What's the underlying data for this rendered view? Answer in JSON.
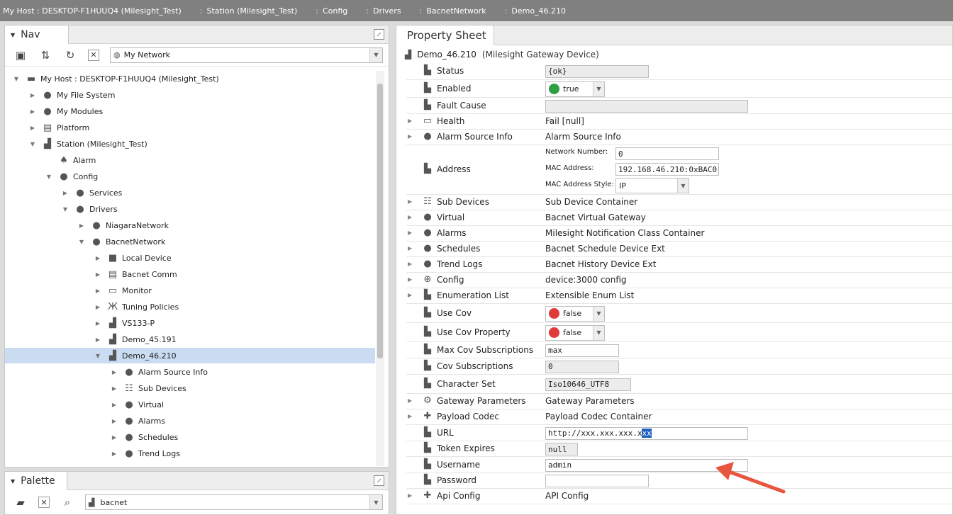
{
  "breadcrumb": [
    {
      "label": "My Host : DESKTOP-F1HUUQ4 (Milesight_Test)"
    },
    {
      "label": "Station (Milesight_Test)"
    },
    {
      "label": "Config"
    },
    {
      "label": "Drivers"
    },
    {
      "label": "BacnetNetwork"
    },
    {
      "label": "Demo_46.210"
    }
  ],
  "nav": {
    "title": "Nav",
    "network_select": "My Network",
    "tree": [
      {
        "label": "My Host : DESKTOP-F1HUUQ4 (Milesight_Test)",
        "icon": "host-icon",
        "depth": 0,
        "toggle": "▼",
        "glyph": "▬"
      },
      {
        "label": "My File System",
        "icon": "file-system-icon",
        "depth": 1,
        "toggle": "▶",
        "glyph": "●"
      },
      {
        "label": "My Modules",
        "icon": "modules-icon",
        "depth": 1,
        "toggle": "▶",
        "glyph": "●"
      },
      {
        "label": "Platform",
        "icon": "platform-icon",
        "depth": 1,
        "toggle": "▶",
        "glyph": "▤"
      },
      {
        "label": "Station (Milesight_Test)",
        "icon": "station-icon",
        "depth": 1,
        "toggle": "▼",
        "glyph": "▟"
      },
      {
        "label": "Alarm",
        "icon": "bell-icon",
        "depth": 2,
        "toggle": "",
        "glyph": "♠"
      },
      {
        "label": "Config",
        "icon": "config-icon",
        "depth": 2,
        "toggle": "▼",
        "glyph": "●"
      },
      {
        "label": "Services",
        "icon": "services-icon",
        "depth": 3,
        "toggle": "▶",
        "glyph": "●"
      },
      {
        "label": "Drivers",
        "icon": "drivers-icon",
        "depth": 3,
        "toggle": "▼",
        "glyph": "●"
      },
      {
        "label": "NiagaraNetwork",
        "icon": "network-icon",
        "depth": 4,
        "toggle": "▶",
        "glyph": "●"
      },
      {
        "label": "BacnetNetwork",
        "icon": "network-icon",
        "depth": 4,
        "toggle": "▼",
        "glyph": "●"
      },
      {
        "label": "Local Device",
        "icon": "local-device-icon",
        "depth": 5,
        "toggle": "▶",
        "glyph": "■"
      },
      {
        "label": "Bacnet Comm",
        "icon": "bacnet-comm-icon",
        "depth": 5,
        "toggle": "▶",
        "glyph": "▤"
      },
      {
        "label": "Monitor",
        "icon": "monitor-icon",
        "depth": 5,
        "toggle": "▶",
        "glyph": "▭"
      },
      {
        "label": "Tuning Policies",
        "icon": "tuning-icon",
        "depth": 5,
        "toggle": "▶",
        "glyph": "Ж"
      },
      {
        "label": "VS133-P",
        "icon": "device-icon",
        "depth": 5,
        "toggle": "▶",
        "glyph": "▟"
      },
      {
        "label": "Demo_45.191",
        "icon": "device-icon",
        "depth": 5,
        "toggle": "▶",
        "glyph": "▟"
      },
      {
        "label": "Demo_46.210",
        "icon": "device-icon",
        "depth": 5,
        "toggle": "▼",
        "glyph": "▟",
        "selected": true
      },
      {
        "label": "Alarm Source Info",
        "icon": "alarm-source-icon",
        "depth": 6,
        "toggle": "▶",
        "glyph": "●"
      },
      {
        "label": "Sub Devices",
        "icon": "sub-devices-icon",
        "depth": 6,
        "toggle": "▶",
        "glyph": "☷"
      },
      {
        "label": "Virtual",
        "icon": "virtual-icon",
        "depth": 6,
        "toggle": "▶",
        "glyph": "●"
      },
      {
        "label": "Alarms",
        "icon": "alarms-icon",
        "depth": 6,
        "toggle": "▶",
        "glyph": "●"
      },
      {
        "label": "Schedules",
        "icon": "schedules-icon",
        "depth": 6,
        "toggle": "▶",
        "glyph": "●"
      },
      {
        "label": "Trend Logs",
        "icon": "trend-logs-icon",
        "depth": 6,
        "toggle": "▶",
        "glyph": "●"
      }
    ]
  },
  "palette": {
    "title": "Palette",
    "select": "bacnet"
  },
  "property_sheet": {
    "tab": "Property Sheet",
    "device_name": "Demo_46.210",
    "device_type": "(Milesight Gateway Device)",
    "rows": [
      {
        "name": "Status",
        "icon": "slot-icon",
        "glyph": "▙",
        "exp": "",
        "kind": "field",
        "value": "{ok}",
        "ro": true,
        "fw": 146,
        "h": 25
      },
      {
        "name": "Enabled",
        "icon": "slot-icon",
        "glyph": "▙",
        "exp": "",
        "kind": "bool",
        "value": "true",
        "dot": "#2ea043",
        "h": 25
      },
      {
        "name": "Fault Cause",
        "icon": "slot-icon",
        "glyph": "▙",
        "exp": "",
        "kind": "field",
        "value": "",
        "ro": true,
        "fw": 286,
        "h": 23
      },
      {
        "name": "Health",
        "icon": "health-icon",
        "glyph": "▭",
        "exp": "▶",
        "kind": "text",
        "value": "Fail [null]",
        "h": 22
      },
      {
        "name": "Alarm Source Info",
        "icon": "alarm-source-icon",
        "glyph": "●",
        "exp": "▶",
        "kind": "text",
        "value": "Alarm Source Info",
        "h": 22
      },
      {
        "name": "Address",
        "icon": "slot-icon",
        "glyph": "▙",
        "exp": "",
        "kind": "address",
        "h": 70
      },
      {
        "name": "Sub Devices",
        "icon": "sub-devices-icon",
        "glyph": "☷",
        "exp": "▶",
        "kind": "text",
        "value": "Sub Device Container",
        "h": 22
      },
      {
        "name": "Virtual",
        "icon": "virtual-icon",
        "glyph": "●",
        "exp": "▶",
        "kind": "text",
        "value": "Bacnet Virtual Gateway",
        "h": 22
      },
      {
        "name": "Alarms",
        "icon": "alarms-icon",
        "glyph": "●",
        "exp": "▶",
        "kind": "text",
        "value": "Milesight Notification Class Container",
        "h": 22
      },
      {
        "name": "Schedules",
        "icon": "schedules-icon",
        "glyph": "●",
        "exp": "▶",
        "kind": "text",
        "value": "Bacnet Schedule Device Ext",
        "h": 22
      },
      {
        "name": "Trend Logs",
        "icon": "trend-logs-icon",
        "glyph": "●",
        "exp": "▶",
        "kind": "text",
        "value": "Bacnet History Device Ext",
        "h": 22
      },
      {
        "name": "Config",
        "icon": "config-icon",
        "glyph": "⊕",
        "exp": "▶",
        "kind": "text",
        "value": "device:3000 config",
        "h": 22
      },
      {
        "name": "Enumeration List",
        "icon": "slot-icon",
        "glyph": "▙",
        "exp": "▶",
        "kind": "text",
        "value": "Extensible Enum List",
        "h": 22
      },
      {
        "name": "Use Cov",
        "icon": "slot-icon",
        "glyph": "▙",
        "exp": "",
        "kind": "bool",
        "value": "false",
        "dot": "#e03a3a",
        "h": 27
      },
      {
        "name": "Use Cov Property",
        "icon": "slot-icon",
        "glyph": "▙",
        "exp": "",
        "kind": "bool",
        "value": "false",
        "dot": "#e03a3a",
        "h": 27
      },
      {
        "name": "Max Cov Subscriptions",
        "icon": "slot-icon",
        "glyph": "▙",
        "exp": "",
        "kind": "field",
        "value": "max",
        "ro": false,
        "fw": 104,
        "h": 23
      },
      {
        "name": "Cov Subscriptions",
        "icon": "slot-icon",
        "glyph": "▙",
        "exp": "",
        "kind": "field",
        "value": "0",
        "ro": true,
        "fw": 104,
        "h": 23
      },
      {
        "name": "Character Set",
        "icon": "slot-icon",
        "glyph": "▙",
        "exp": "",
        "kind": "field",
        "value": "Iso10646_UTF8",
        "ro": true,
        "fw": 121,
        "h": 27
      },
      {
        "name": "Gateway Parameters",
        "icon": "gear-icon",
        "glyph": "⚙",
        "exp": "▶",
        "kind": "text",
        "value": "Gateway Parameters",
        "h": 22
      },
      {
        "name": "Payload Codec",
        "icon": "puzzle-icon",
        "glyph": "✚",
        "exp": "▶",
        "kind": "text",
        "value": "Payload Codec Container",
        "h": 22
      },
      {
        "name": "URL",
        "icon": "slot-icon",
        "glyph": "▙",
        "exp": "",
        "kind": "url",
        "value": "http://xxx.xxx.xxx.x",
        "sel": "xx",
        "fw": 286,
        "h": 23
      },
      {
        "name": "Token Expires",
        "icon": "slot-icon",
        "glyph": "▙",
        "exp": "",
        "kind": "field",
        "value": "null",
        "ro": true,
        "fw": 46,
        "h": 22
      },
      {
        "name": "Username",
        "icon": "slot-icon",
        "glyph": "▙",
        "exp": "",
        "kind": "field",
        "value": "admin",
        "ro": false,
        "fw": 286,
        "h": 23
      },
      {
        "name": "Password",
        "icon": "slot-icon",
        "glyph": "▙",
        "exp": "",
        "kind": "field",
        "value": "",
        "ro": false,
        "fw": 146,
        "h": 22
      },
      {
        "name": "Api Config",
        "icon": "puzzle-icon",
        "glyph": "✚",
        "exp": "▶",
        "kind": "text",
        "value": "API Config",
        "h": 22
      }
    ],
    "address": {
      "network_number_label": "Network Number:",
      "network_number": "0",
      "mac_address_label": "MAC Address:",
      "mac_address": "192.168.46.210:0xBAC0",
      "mac_style_label": "MAC Address Style:",
      "mac_style": "IP"
    }
  },
  "colors": {
    "annotation_arrow": "#e8563f"
  }
}
